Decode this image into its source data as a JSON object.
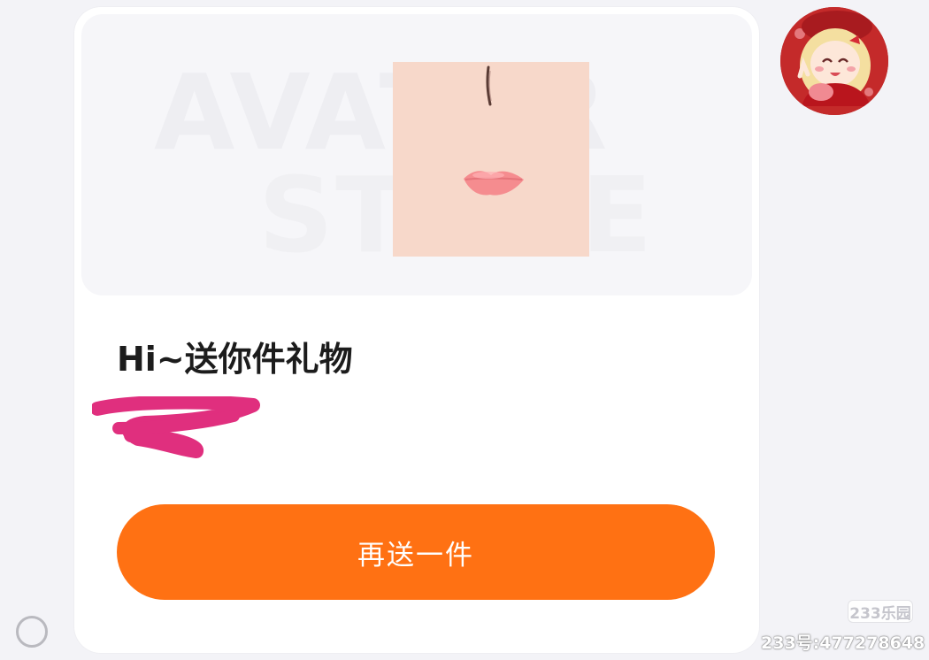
{
  "gift_card": {
    "preview_watermark": [
      "AVATAR",
      "STORE"
    ],
    "greeting": "Hi~送你件礼物",
    "resend_button_label": "再送一件",
    "button_color": "#ff7113"
  },
  "sender": {
    "avatar_icon": "anime-girl-avatar"
  },
  "overlay_watermark": {
    "badge": "233乐园",
    "id_text": "233号:477278648"
  }
}
